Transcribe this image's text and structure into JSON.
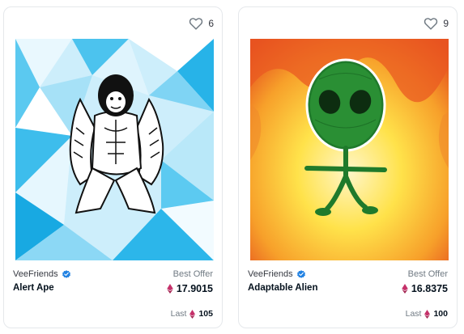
{
  "cards": [
    {
      "favorites": "6",
      "collection": "VeeFriends",
      "name": "Alert Ape",
      "offer_label": "Best Offer",
      "best_offer": "17.9015",
      "last_label": "Last",
      "last_price": "105"
    },
    {
      "favorites": "9",
      "collection": "VeeFriends",
      "name": "Adaptable Alien",
      "offer_label": "Best Offer",
      "best_offer": "16.8375",
      "last_label": "Last",
      "last_price": "100"
    }
  ],
  "colors": {
    "verified": "#2081e2",
    "eth": "#c5316a",
    "muted": "#707a83",
    "border": "#e5e8eb"
  },
  "icons": {
    "favorite": "heart-icon",
    "verified": "verified-badge-icon",
    "currency": "ethereum-icon"
  }
}
